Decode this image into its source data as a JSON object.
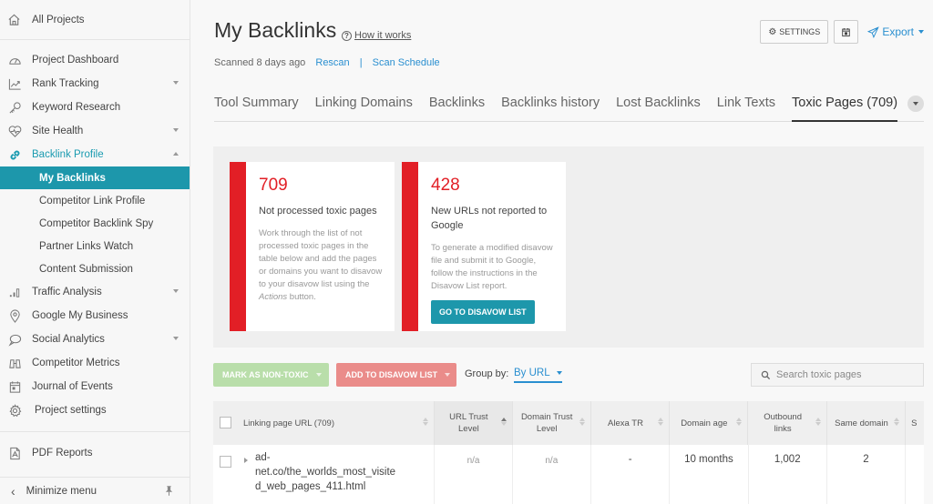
{
  "sidebar": {
    "all_projects": "All Projects",
    "items": [
      {
        "label": "Project Dashboard",
        "icon": "dashboard-icon"
      },
      {
        "label": "Rank Tracking",
        "icon": "chart-icon",
        "has_caret": true
      },
      {
        "label": "Keyword Research",
        "icon": "key-icon"
      },
      {
        "label": "Site Health",
        "icon": "heart-icon",
        "has_caret": true
      },
      {
        "label": "Backlink Profile",
        "icon": "link-icon",
        "expanded": true,
        "children": [
          {
            "label": "My Backlinks",
            "active": true
          },
          {
            "label": "Competitor Link Profile"
          },
          {
            "label": "Competitor Backlink Spy"
          },
          {
            "label": "Partner Links Watch"
          },
          {
            "label": "Content Submission"
          }
        ]
      },
      {
        "label": "Traffic Analysis",
        "icon": "bars-icon",
        "has_caret": true
      },
      {
        "label": "Google My Business",
        "icon": "location-pin-icon"
      },
      {
        "label": "Social Analytics",
        "icon": "speech-bubble-icon",
        "has_caret": true
      },
      {
        "label": "Competitor Metrics",
        "icon": "binoculars-icon"
      },
      {
        "label": "Journal of Events",
        "icon": "calendar-icon"
      },
      {
        "label": "Project settings",
        "icon": "gear-icon"
      }
    ],
    "pdf_reports": "PDF Reports",
    "minimize": "Minimize menu"
  },
  "header": {
    "title": "My Backlinks",
    "how_it_works": "How it works",
    "scanned": "Scanned 8 days ago",
    "rescan": "Rescan",
    "separator": "|",
    "scan_schedule": "Scan Schedule",
    "settings_label": "SETTINGS",
    "export_label": "Export"
  },
  "tabs": [
    {
      "label": "Tool Summary"
    },
    {
      "label": "Linking Domains"
    },
    {
      "label": "Backlinks"
    },
    {
      "label": "Backlinks history"
    },
    {
      "label": "Lost Backlinks"
    },
    {
      "label": "Link Texts"
    },
    {
      "label": "Toxic Pages (709)",
      "active": true
    }
  ],
  "summary": {
    "card1": {
      "number": "709",
      "label": "Not processed toxic pages",
      "desc_pre": "Work through the list of not processed toxic pages in the table below and add the pages or domains you want to disavow to your disavow list using the ",
      "desc_em": "Actions",
      "desc_post": " button."
    },
    "card2": {
      "number": "428",
      "label": "New URLs not reported to Google",
      "desc": "To generate a modified disavow file and submit it to Google, follow the instructions in the Disavow List report.",
      "button": "GO TO DISAVOW LIST"
    },
    "accent_color": "#e21f26"
  },
  "actions": {
    "mark_non_toxic": "MARK AS NON-TOXIC",
    "add_to_disavow": "ADD TO DISAVOW LIST",
    "group_by_label": "Group by:",
    "group_by_value": "By URL",
    "search_placeholder": "Search toxic pages"
  },
  "table": {
    "columns": [
      "Linking page URL (709)",
      "URL Trust Level",
      "Domain Trust Level",
      "Alexa TR",
      "Domain age",
      "Outbound links",
      "Same domain",
      "S"
    ],
    "rows": [
      {
        "url": "ad-net.co/the_worlds_most_visited_web_pages_411.html",
        "url_lines": [
          "ad-",
          "net.co/the_worlds_most_visite",
          "d_web_pages_411.html"
        ],
        "url_trust": "n/a",
        "domain_trust": "n/a",
        "alexa_tr": "-",
        "domain_age": "10 months",
        "outbound_links": "1,002",
        "same_domain": "2"
      }
    ]
  }
}
